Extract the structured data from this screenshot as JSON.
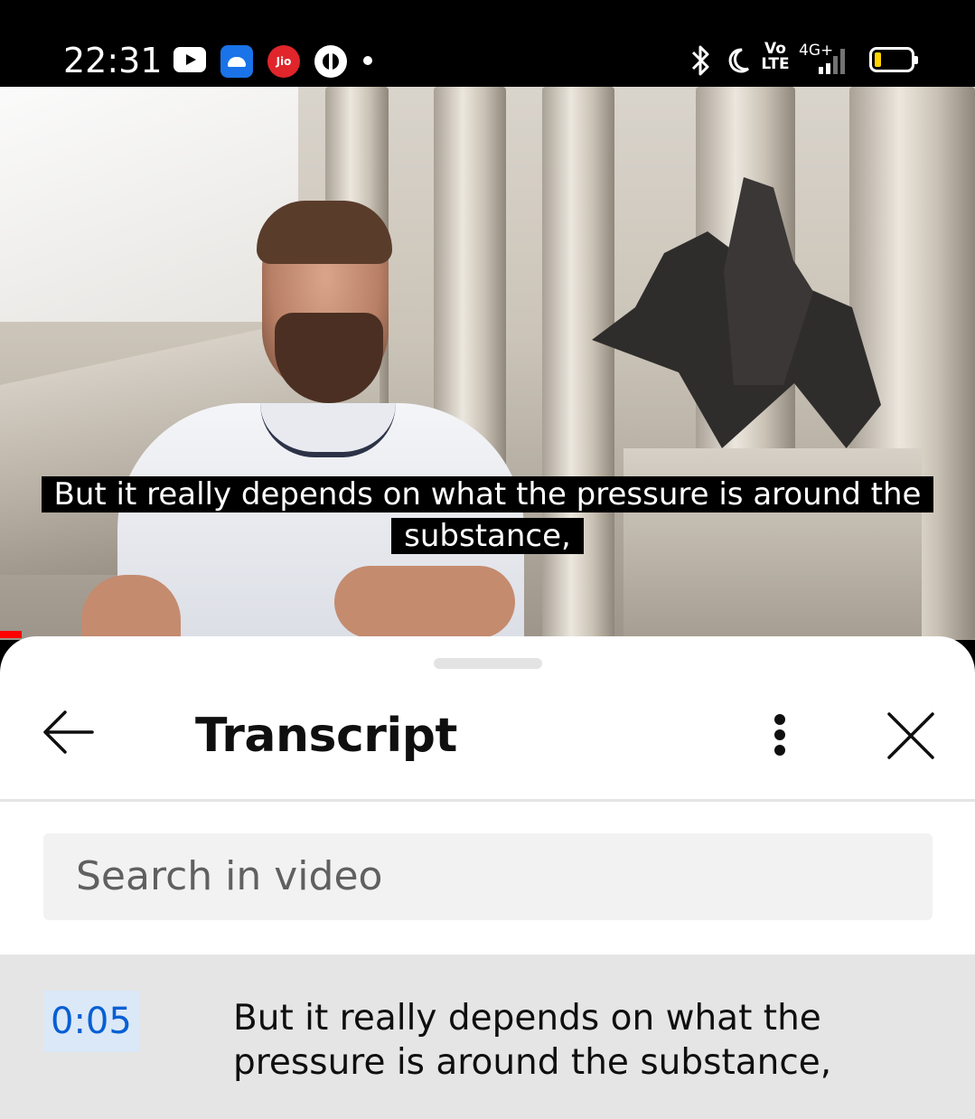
{
  "status_bar": {
    "time": "22:31",
    "icons": [
      "youtube-icon",
      "android-icon",
      "jio-icon",
      "game-icon",
      "notification-dot",
      "bluetooth-icon",
      "dnd-moon-icon",
      "volte-icon",
      "signal-4g-icon",
      "battery-icon"
    ],
    "jio_label": "Jio",
    "volte_label": "Vo\nLTE",
    "network_label": "4G+",
    "battery_color": "#ffd400"
  },
  "video": {
    "caption_line1": "But it really depends on what the pressure is around the",
    "caption_line2": "substance,",
    "progress_color": "#ff0000"
  },
  "transcript_panel": {
    "back_icon": "arrow-left-icon",
    "title": "Transcript",
    "more_icon": "more-vertical-icon",
    "close_icon": "close-icon",
    "search_placeholder": "Search in video",
    "segments": [
      {
        "timestamp": "0:05",
        "text": "But it really depends on what the pressure is around the substance,"
      }
    ],
    "timestamp_color": "#065fd4"
  }
}
